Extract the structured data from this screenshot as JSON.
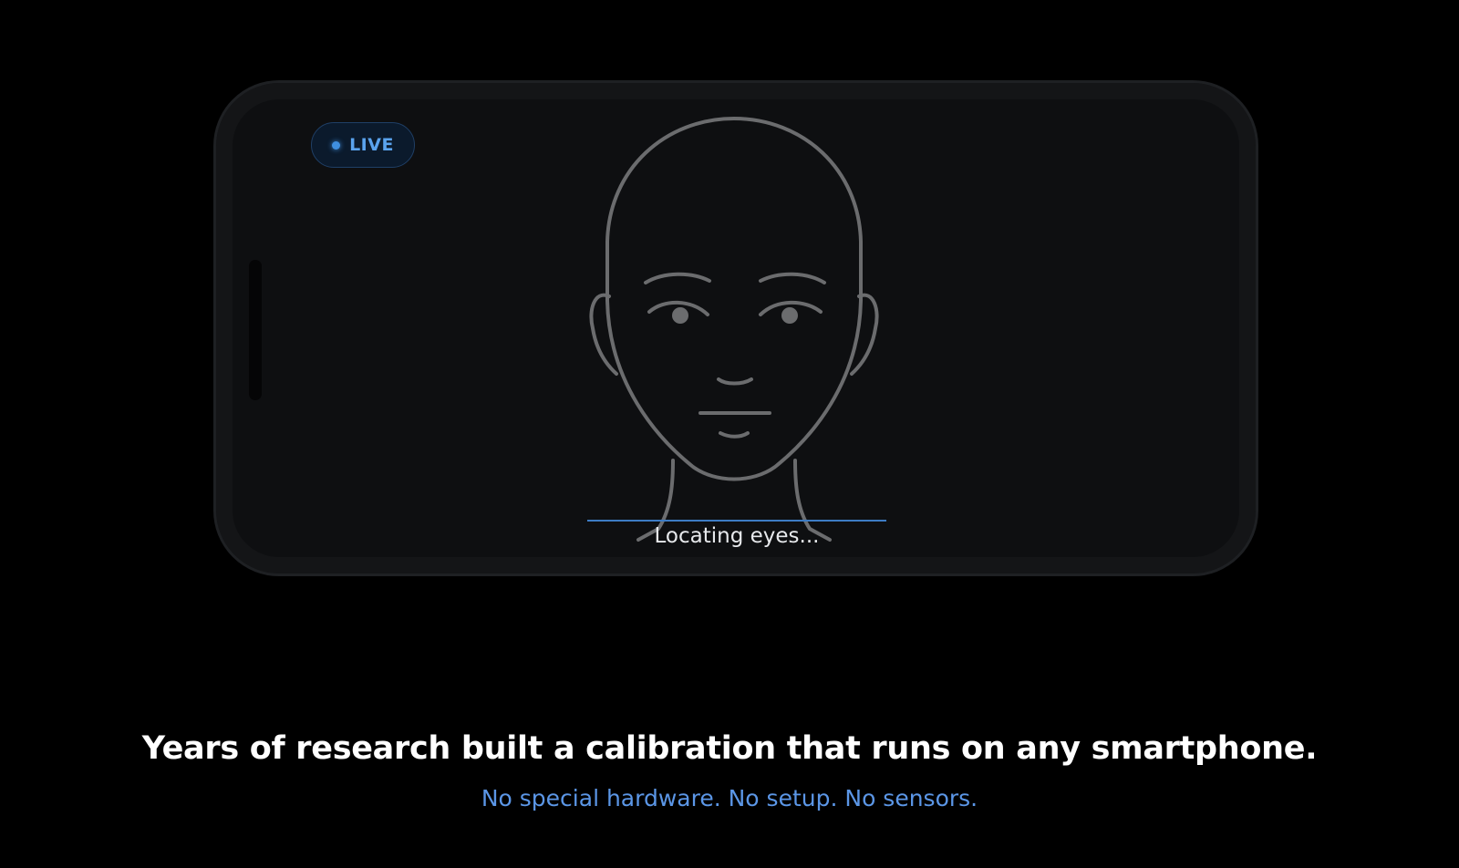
{
  "badge": {
    "label": "LIVE"
  },
  "scanner": {
    "status": "Locating eyes..."
  },
  "caption": {
    "headline": "Years of research built a calibration that runs on any smartphone.",
    "subheadline": "No special hardware. No setup. No sensors."
  },
  "colors": {
    "accent": "#5b96e6",
    "badge_text": "#5aa3ee",
    "background": "#000000",
    "face_outline": "#6b6c6e"
  },
  "icons": {
    "face": "face-outline-icon",
    "live_dot": "live-dot-icon"
  }
}
